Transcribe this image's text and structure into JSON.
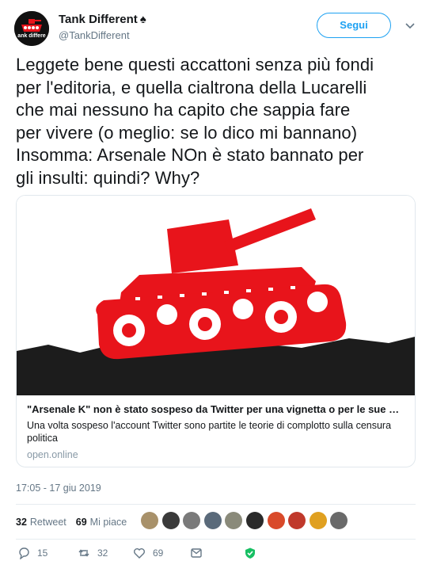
{
  "header": {
    "display_name": "Tank Different",
    "handle": "@TankDifferent",
    "follow_label": "Segui",
    "avatar_text": "ank differe"
  },
  "tweet": {
    "lines": [
      "Leggete bene questi accattoni senza più fondi",
      "per l'editoria, e quella cialtrona della Lucarelli",
      "che mai nessuno ha capito che sappia fare",
      "per vivere (o meglio: se lo dico mi bannano)",
      "Insomma: Arsenale NOn è stato bannato per",
      "gli insulti: quindi? Why?"
    ]
  },
  "card": {
    "title": "\"Arsenale K\" non è stato sospeso da Twitter per una vignetta o per le sue opi...",
    "description": "Una volta sospeso l'account Twitter sono partite le teorie di complotto sulla censura politica",
    "domain": "open.online"
  },
  "timestamp": "17:05 - 17 giu 2019",
  "stats": {
    "retweets": "32",
    "retweets_label": "Retweet",
    "likes": "69",
    "likes_label": "Mi piace"
  },
  "actions": {
    "replies": "15",
    "retweets": "32",
    "likes": "69"
  },
  "colors": {
    "accent": "#1da1f2",
    "tank_red": "#e8141b",
    "verified_green": "#17bf63"
  },
  "liker_avatar_colors": [
    "#a8916a",
    "#3a3a3a",
    "#7a7a7a",
    "#5a6a7a",
    "#8a8a7a",
    "#2a2a2a",
    "#d94a2a",
    "#c0392b",
    "#e0a020",
    "#6a6a6a"
  ]
}
